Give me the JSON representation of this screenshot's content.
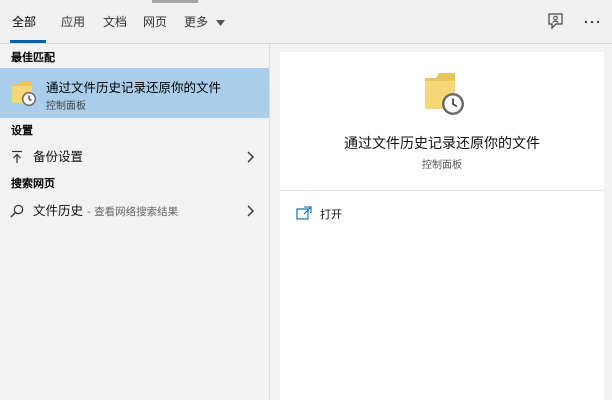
{
  "tabs": [
    {
      "label": "全部"
    },
    {
      "label": "应用"
    },
    {
      "label": "文档"
    },
    {
      "label": "网页"
    },
    {
      "label": "更多"
    }
  ],
  "colors": {
    "accent": "#0063b1",
    "selection": "#a9cdea"
  },
  "sections": {
    "best_match": "最佳匹配",
    "settings": "设置",
    "web": "搜索网页"
  },
  "best_match": {
    "title": "通过文件历史记录还原你的文件",
    "subtitle": "控制面板",
    "icon": "folder-history-icon"
  },
  "settings_item": {
    "label": "备份设置",
    "icon": "arrow-up-icon"
  },
  "web_item": {
    "label": "文件历史",
    "hint": "- 查看网络搜索结果",
    "icon": "search-icon"
  },
  "preview": {
    "title": "通过文件历史记录还原你的文件",
    "subtitle": "控制面板",
    "actions": [
      {
        "label": "打开",
        "icon": "open-icon"
      }
    ]
  }
}
